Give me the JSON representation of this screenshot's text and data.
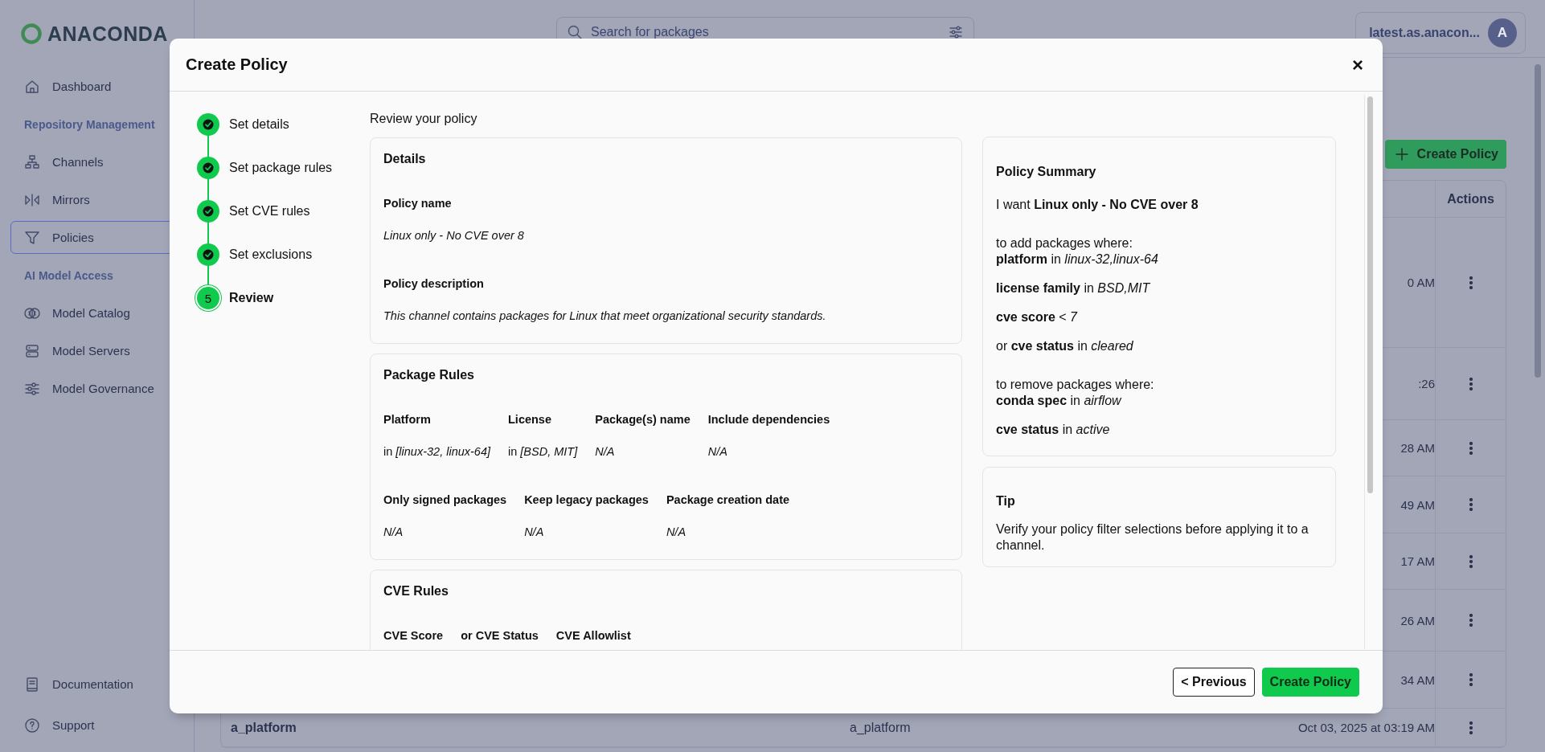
{
  "app": {
    "logo": "ANACONDA",
    "search": {
      "placeholder": "Search for packages"
    },
    "account": {
      "name": "latest.as.anacon...",
      "avatar": "A"
    }
  },
  "sidebar": {
    "items": [
      {
        "kind": "link",
        "label": "Dashboard",
        "selected": false
      },
      {
        "kind": "section",
        "label": "Repository Management"
      },
      {
        "kind": "link",
        "label": "Channels",
        "selected": false
      },
      {
        "kind": "link",
        "label": "Mirrors",
        "selected": false
      },
      {
        "kind": "link",
        "label": "Policies",
        "selected": true
      },
      {
        "kind": "section",
        "label": "AI Model Access"
      },
      {
        "kind": "link",
        "label": "Model Catalog",
        "selected": false
      },
      {
        "kind": "link",
        "label": "Model Servers",
        "selected": false
      },
      {
        "kind": "link",
        "label": "Model Governance",
        "selected": false
      }
    ],
    "footer_items": [
      {
        "label": "Documentation"
      },
      {
        "label": "Support"
      }
    ]
  },
  "page": {
    "create_button": "Create Policy",
    "table": {
      "columns": [
        {
          "label": "Actions"
        }
      ],
      "rows": [
        {
          "column_3": "0 AM"
        },
        {
          "column_3": ":26"
        },
        {
          "column_3": "28 AM"
        },
        {
          "column_3": "49 AM"
        },
        {
          "column_3": "17 AM"
        },
        {
          "column_3": "26 AM"
        },
        {
          "column_3": "34 AM"
        },
        {
          "column_1": "a_platform",
          "column_2": "a_platform",
          "column_3": "Oct 03, 2025 at 03:19 AM"
        }
      ]
    }
  },
  "modal": {
    "title": "Create Policy",
    "close": "×",
    "steps": [
      {
        "label": "Set details",
        "completed": true,
        "selected": false
      },
      {
        "label": "Set package rules",
        "completed": true,
        "selected": false
      },
      {
        "label": "Set CVE rules",
        "completed": true,
        "selected": false
      },
      {
        "label": "Set exclusions",
        "completed": true,
        "selected": false
      },
      {
        "label": "Review",
        "completed": false,
        "selected": true,
        "number": "5"
      }
    ],
    "heading": "Review your policy",
    "cards": [
      {
        "title": "Details",
        "kind": "stack",
        "groups": [
          [
            {
              "label": "Policy name",
              "value": "*Linux only - No CVE over 8*"
            }
          ],
          [
            {
              "label": "Policy description",
              "value": "*This channel contains packages for Linux that meet organizational security standards.*"
            }
          ]
        ]
      },
      {
        "title": "Package Rules",
        "kind": "grid",
        "groups": [
          [
            {
              "label": "Platform",
              "value": "in *[linux-32, linux-64]*"
            },
            {
              "label": "License",
              "value": "in *[BSD, MIT]*"
            },
            {
              "label": "Package(s) name",
              "value": "*N/A*"
            },
            {
              "label": "Include dependencies",
              "value": "*N/A*"
            }
          ],
          [
            {
              "label": "Only signed packages",
              "value": "*N/A*"
            },
            {
              "label": "Keep legacy packages",
              "value": "*N/A*"
            },
            {
              "label": "Package creation date",
              "value": "*N/A*"
            }
          ]
        ]
      },
      {
        "title": "CVE Rules",
        "kind": "grid",
        "groups": [
          [
            {
              "label": "CVE Score"
            },
            {
              "label": "or CVE Status"
            },
            {
              "label": "CVE Allowlist"
            }
          ]
        ]
      }
    ],
    "summary": {
      "title": "Policy Summary",
      "sections": [
        {
          "paragraphs": [
            [
              "I want **Linux only - No CVE over 8**"
            ]
          ]
        },
        {
          "paragraphs": [
            [
              "to add packages where:",
              "**platform** in *linux-32,linux-64*"
            ],
            [
              "**license family** in *BSD,MIT*"
            ],
            [
              "**cve score** < *7*"
            ],
            [
              "or **cve status** in *cleared*"
            ]
          ]
        },
        {
          "paragraphs": [
            [
              "to remove packages where:",
              "**conda spec** in *airflow*"
            ],
            [
              "**cve status** in *active*"
            ]
          ]
        }
      ]
    },
    "tip": {
      "title": "Tip",
      "text": "Verify your policy filter selections before applying it to a channel."
    },
    "buttons": [
      {
        "label": "< Previous",
        "kind": "secondary"
      },
      {
        "label": "Create Policy",
        "kind": "primary"
      }
    ]
  }
}
